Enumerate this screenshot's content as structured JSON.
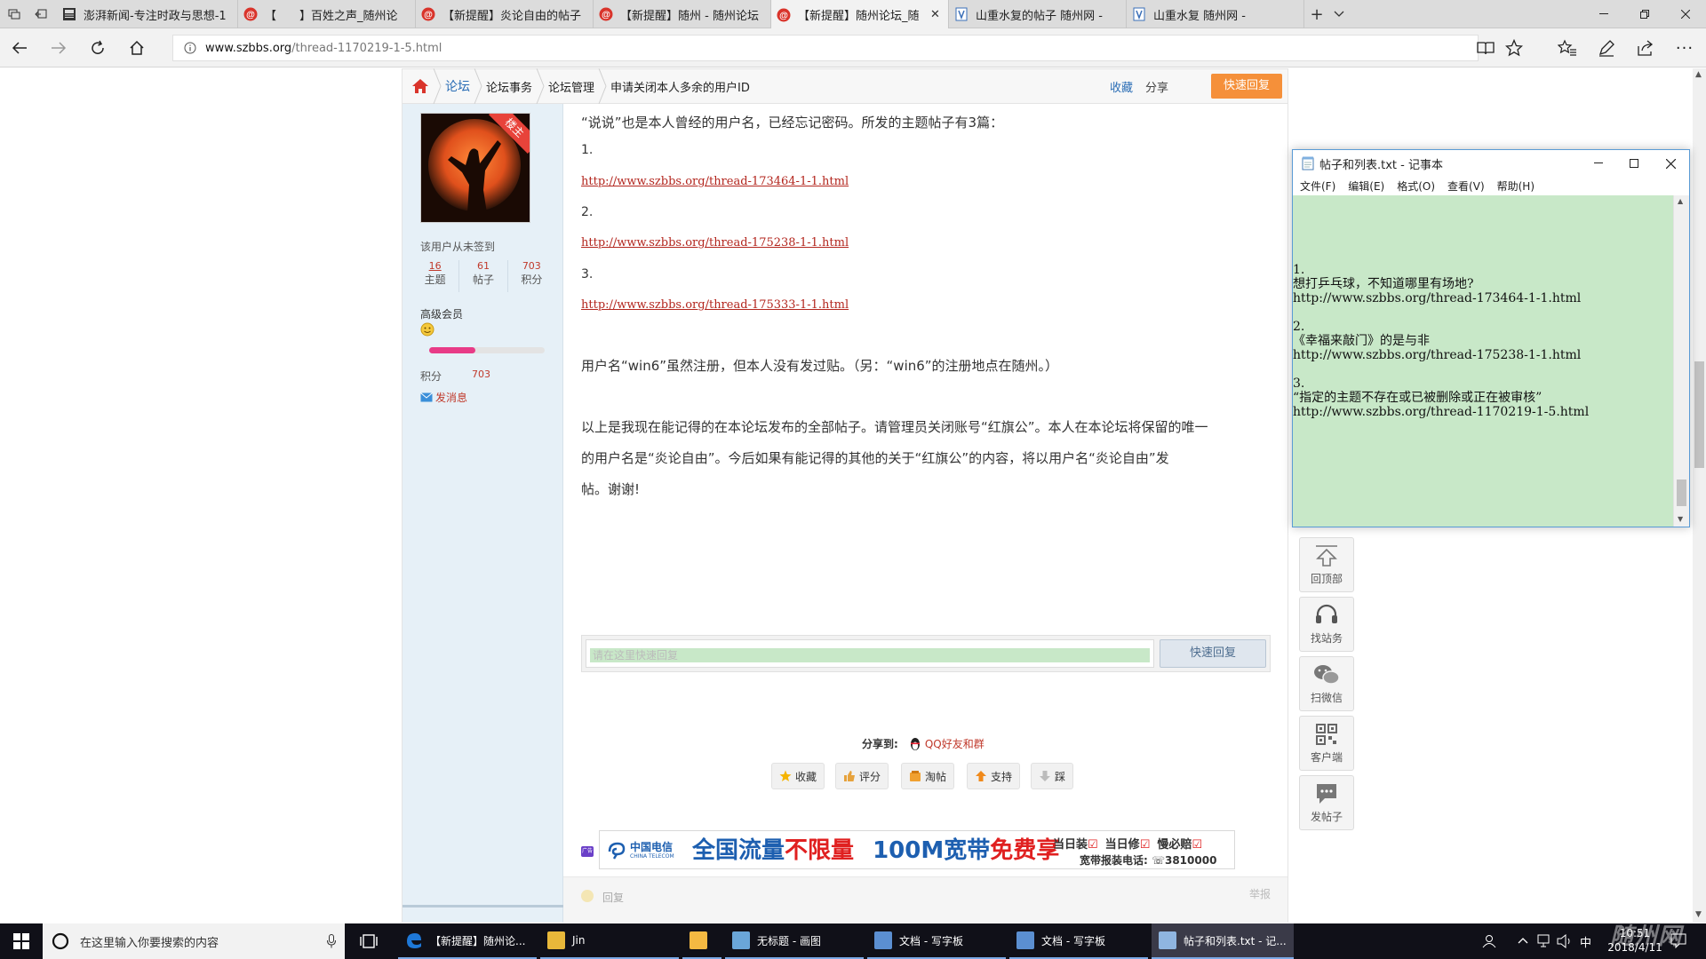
{
  "browser": {
    "tabs": [
      {
        "title": "澎湃新闻-专注时政与思想-1",
        "icon": "paper-icon"
      },
      {
        "title": "【　　】百姓之声_随州论",
        "icon": "szbbs-icon"
      },
      {
        "title": "【新提醒】炎论自由的帖子",
        "icon": "szbbs-icon"
      },
      {
        "title": "【新提醒】随州 - 随州论坛",
        "icon": "szbbs-icon"
      },
      {
        "title": "【新提醒】随州论坛_随",
        "icon": "szbbs-icon",
        "active": true
      },
      {
        "title": "山重水复的帖子 随州网 -",
        "icon": "doc-icon"
      },
      {
        "title": "山重水复 随州网 -",
        "icon": "doc-icon"
      }
    ],
    "url": {
      "domain": "www.szbbs.org",
      "path": "/thread-1170219-1-5.html"
    }
  },
  "breadcrumb": {
    "home": "论坛",
    "items": [
      "论坛事务",
      "论坛管理",
      "申请关闭本人多余的用户ID"
    ],
    "fav": "收藏",
    "share": "分享",
    "quick_reply": "快速回复"
  },
  "author": {
    "badge": "楼主",
    "signin": "该用户从未签到",
    "stats": [
      {
        "value": "16",
        "label": "主题"
      },
      {
        "value": "61",
        "label": "帖子"
      },
      {
        "value": "703",
        "label": "积分"
      }
    ],
    "group": "高级会员",
    "progress": 0.4,
    "points_label": "积分",
    "points_value": "703",
    "message": "发消息"
  },
  "post": {
    "intro": "“说说”也是本人曾经的用户名，已经忘记密码。所发的主题帖子有3篇：",
    "links": [
      {
        "num": "1.",
        "url": "http://www.szbbs.org/thread-173464-1-1.html"
      },
      {
        "num": "2.",
        "url": "http://www.szbbs.org/thread-175238-1-1.html"
      },
      {
        "num": "3.",
        "url": "http://www.szbbs.org/thread-175333-1-1.html"
      }
    ],
    "para2": "用户名“win6”虽然注册，但本人没有发过贴。（另：“win6”的注册地点在随州。）",
    "para3_lines": [
      "以上是我现在能记得的在本论坛发布的全部帖子。请管理员关闭账号“红旗公”。本人在本论坛将保留的唯一",
      "的用户名是“炎论自由”。今后如果有能记得的其他的关于“红旗公”的内容，将以用户名“炎论自由”发",
      "帖。谢谢!"
    ]
  },
  "reply_box": {
    "placeholder": "请在这里快速回复",
    "button": "快速回复"
  },
  "share_bar": {
    "label": "分享到:",
    "qq": "QQ好友和群"
  },
  "actions": [
    "收藏",
    "评分",
    "淘帖",
    "支持",
    "踩"
  ],
  "ad": {
    "tag": "广告",
    "brand": "中国电信",
    "brand_en": "CHINA TELECOM",
    "slogan1": "全国流量",
    "slogan1b": "不限量",
    "slogan2": "100M宽带",
    "slogan2b": "免费享",
    "checks": [
      "当日装",
      "当日修",
      "慢必赔"
    ],
    "phone": "宽带报装电话: ☏3810000"
  },
  "reply_row": {
    "label": "回复",
    "report": "举报"
  },
  "tools": [
    {
      "label": "回顶部",
      "icon": "up-arrow-icon"
    },
    {
      "label": "找站务",
      "icon": "headset-icon"
    },
    {
      "label": "扫微信",
      "icon": "wechat-icon"
    },
    {
      "label": "客户端",
      "icon": "qrcode-icon"
    },
    {
      "label": "发帖子",
      "icon": "chat-bubble-icon"
    }
  ],
  "notepad": {
    "title": "帖子和列表.txt - 记事本",
    "menu": [
      "文件(F)",
      "编辑(E)",
      "格式(O)",
      "查看(V)",
      "帮助(H)"
    ],
    "text": "\n\n\n\n1.\n想打乒乓球，不知道哪里有场地?\nhttp://www.szbbs.org/thread-173464-1-1.html\n\n2.\n《幸福来敲门》的是与非\nhttp://www.szbbs.org/thread-175238-1-1.html\n\n3.\n“指定的主题不存在或已被删除或正在被审核”\nhttp://www.szbbs.org/thread-1170219-1-5.html"
  },
  "taskbar": {
    "search": "在这里输入你要搜索的内容",
    "apps": [
      {
        "label": "【新提醒】随州论...",
        "icon": "edge-icon",
        "active": false,
        "color": "#1e78d8"
      },
      {
        "label": "Jin",
        "icon": "folder-icon",
        "active": false,
        "color": "#e8b83a"
      },
      {
        "label": "",
        "icon": "photos-icon",
        "active": false,
        "color": "#f4b942"
      },
      {
        "label": "无标题 - 画图",
        "icon": "paint-icon",
        "active": false,
        "color": "#6aa6d8"
      },
      {
        "label": "文档 - 写字板",
        "icon": "wordpad-icon",
        "active": false,
        "color": "#5b8fd1"
      },
      {
        "label": "文档 - 写字板",
        "icon": "wordpad-icon",
        "active": false,
        "color": "#5b8fd1"
      },
      {
        "label": "帖子和列表.txt - 记...",
        "icon": "notepad-icon",
        "active": true,
        "color": "#8fb5e0"
      }
    ],
    "ime": "中",
    "time": "10:51",
    "date": "2018/4/11"
  },
  "watermark": "随州网",
  "colors": {
    "accent_orange": "#f5903a",
    "link_red": "#b3261e",
    "sidebar_blue": "#e6f0f7",
    "notepad_green": "#c8e8c8"
  }
}
